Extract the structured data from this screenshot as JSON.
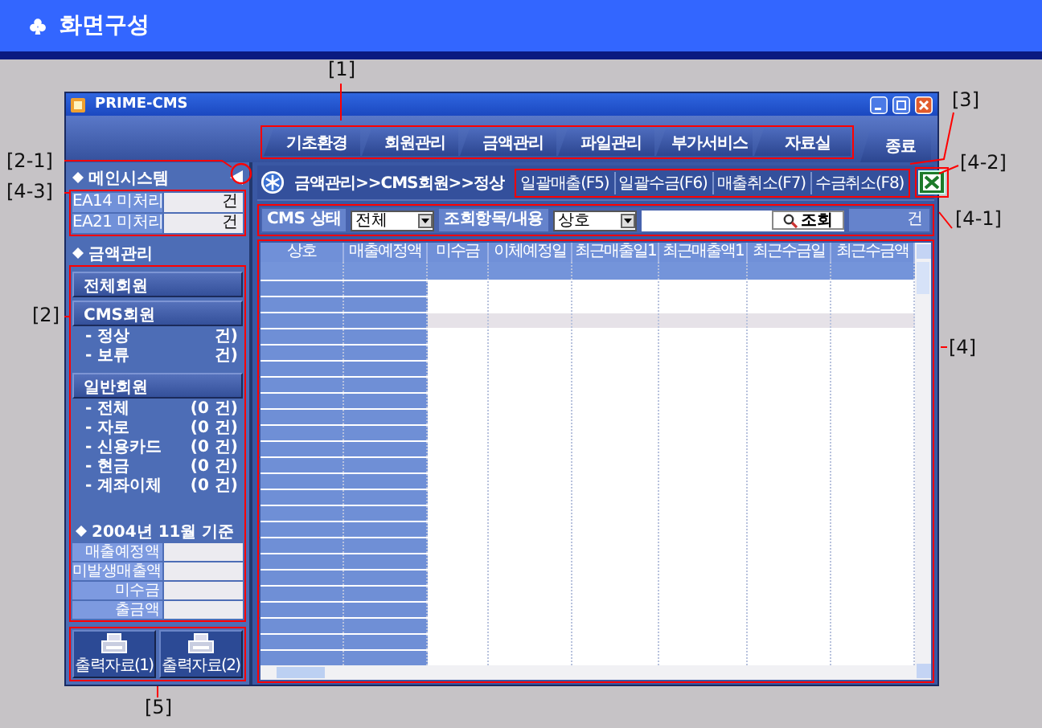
{
  "page_header": {
    "title": "화면구성"
  },
  "window": {
    "title": "PRIME-CMS"
  },
  "tabs": [
    {
      "label": "기초환경"
    },
    {
      "label": "회원관리"
    },
    {
      "label": "금액관리"
    },
    {
      "label": "파일관리"
    },
    {
      "label": "부가서비스"
    },
    {
      "label": "자료실"
    },
    {
      "label": "종료"
    }
  ],
  "sidebar": {
    "main_system": {
      "title": "메인시스템",
      "rows": [
        {
          "label": "EA14 미처리",
          "value": "건"
        },
        {
          "label": "EA21 미처리",
          "value": "건"
        }
      ]
    },
    "amount_section": {
      "title": "금액관리",
      "groups": [
        {
          "label": "전체회원"
        },
        {
          "label": "CMS회원",
          "items": [
            {
              "label": "- 정상",
              "count": "건)"
            },
            {
              "label": "- 보류",
              "count": "건)"
            }
          ]
        },
        {
          "label": "일반회원",
          "items": [
            {
              "label": "- 전체",
              "count": "(0 건)"
            },
            {
              "label": "- 자로",
              "count": "(0 건)"
            },
            {
              "label": "- 신용카드",
              "count": "(0 건)"
            },
            {
              "label": "- 현금",
              "count": "(0 건)"
            },
            {
              "label": "- 계좌이체",
              "count": "(0 건)"
            }
          ]
        }
      ]
    },
    "summary": {
      "title": "2004년 11월 기준",
      "rows": [
        {
          "label": "매출예정액"
        },
        {
          "label": "미발생매출액"
        },
        {
          "label": "미수금"
        },
        {
          "label": "출금액"
        }
      ]
    },
    "print_buttons": [
      "출력자료(1)",
      "출력자료(2)"
    ]
  },
  "breadcrumb": "금액관리>>CMS회원>>정상",
  "actions": [
    "일괄매출(F5)",
    "일괄수금(F6)",
    "매출취소(F7)",
    "수금취소(F8)"
  ],
  "filter": {
    "status_label": "CMS 상태",
    "status_value": "전체",
    "field_label": "조회항목/내용",
    "field_value": "상호",
    "search_button": "조회",
    "count": "건"
  },
  "table": {
    "columns": [
      "상호",
      "매출예정액",
      "미수금",
      "이체예정일",
      "최근매출일1",
      "최근매출액1",
      "최근수금일",
      "최근수금액"
    ],
    "rows": [
      {
        "selected": false
      },
      {
        "selected": false
      },
      {
        "selected": true
      },
      {
        "selected": false
      },
      {
        "selected": false
      },
      {
        "selected": false
      },
      {
        "selected": false
      },
      {
        "selected": false
      },
      {
        "selected": false
      },
      {
        "selected": false
      },
      {
        "selected": false
      },
      {
        "selected": false
      },
      {
        "selected": false
      },
      {
        "selected": false
      },
      {
        "selected": false
      },
      {
        "selected": false
      },
      {
        "selected": false
      },
      {
        "selected": false
      },
      {
        "selected": false
      },
      {
        "selected": false
      },
      {
        "selected": false
      },
      {
        "selected": false
      },
      {
        "selected": false
      },
      {
        "selected": false
      }
    ]
  },
  "annotations": [
    {
      "label": "[1]"
    },
    {
      "label": "[2-1]"
    },
    {
      "label": "[4-3]"
    },
    {
      "label": "[2]"
    },
    {
      "label": "[3]"
    },
    {
      "label": "[4-2]"
    },
    {
      "label": "[4-1]"
    },
    {
      "label": "[4]"
    },
    {
      "label": "[5]"
    }
  ]
}
